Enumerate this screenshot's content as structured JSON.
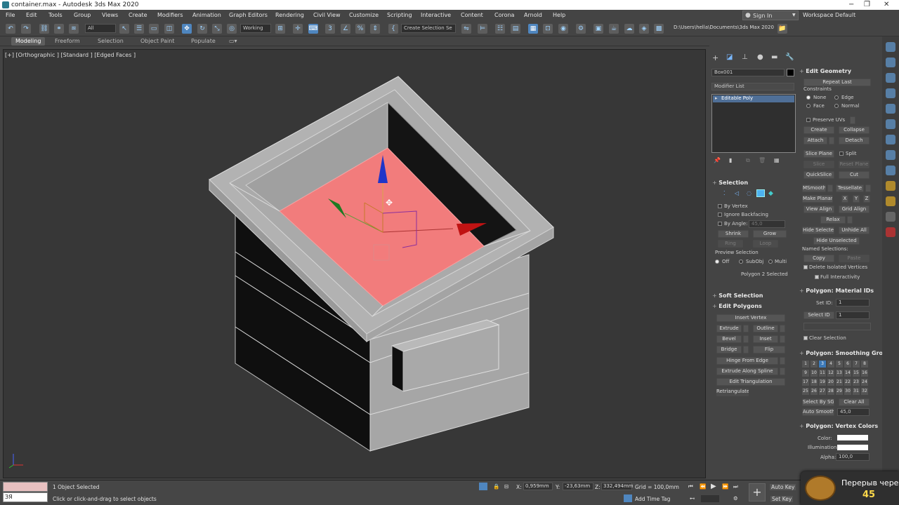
{
  "window": {
    "title": "container.max - Autodesk 3ds Max 2020",
    "minimize": "−",
    "restore": "❐",
    "close": "✕"
  },
  "menus": [
    "File",
    "Edit",
    "Tools",
    "Group",
    "Views",
    "Create",
    "Modifiers",
    "Animation",
    "Graph Editors",
    "Rendering",
    "Civil View",
    "Customize",
    "Scripting",
    "Interactive",
    "Content",
    "Corona",
    "Arnold",
    "Help"
  ],
  "account": {
    "sign_in": "Sign In",
    "workspaces_label": "Workspaces:",
    "workspace": "Default"
  },
  "toolbar": {
    "filter": "All",
    "ref_coord": "Working",
    "selection_set": "Create Selection Se",
    "project_path": "D:\\Users\\hella\\Documents\\3ds Max 2020"
  },
  "ribbon_tabs": [
    "Modeling",
    "Freeform",
    "Selection",
    "Object Paint",
    "Populate"
  ],
  "viewport": {
    "label": "[+] [Orthographic ] [Standard ] [Edged Faces ]"
  },
  "command_panel": {
    "object_name": "Box001",
    "modifier_list": "Modifier List",
    "stack_item": "Editable Poly"
  },
  "selection": {
    "title": "Selection",
    "by_vertex": "By Vertex",
    "ignore_backfacing": "Ignore Backfacing",
    "by_angle": "By Angle:",
    "angle_value": "45,0",
    "shrink": "Shrink",
    "grow": "Grow",
    "ring": "Ring",
    "loop": "Loop",
    "preview_selection": "Preview Selection",
    "off": "Off",
    "subobj": "SubObj",
    "multi": "Multi",
    "status": "Polygon 2 Selected"
  },
  "soft_selection": {
    "title": "Soft Selection"
  },
  "edit_polygons": {
    "title": "Edit Polygons",
    "insert_vertex": "Insert Vertex",
    "extrude": "Extrude",
    "outline": "Outline",
    "bevel": "Bevel",
    "inset": "Inset",
    "bridge": "Bridge",
    "flip": "Flip",
    "hinge": "Hinge From Edge",
    "extrude_spline": "Extrude Along Spline",
    "edit_triangulation": "Edit Triangulation",
    "retriangulate": "Retriangulate"
  },
  "edit_geometry": {
    "title": "Edit Geometry",
    "repeat_last": "Repeat Last",
    "constraints": "Constraints",
    "none": "None",
    "edge": "Edge",
    "face": "Face",
    "normal": "Normal",
    "preserve_uvs": "Preserve UVs",
    "create": "Create",
    "collapse": "Collapse",
    "attach": "Attach",
    "detach": "Detach",
    "slice_plane": "Slice Plane",
    "split": "Split",
    "slice": "Slice",
    "reset_plane": "Reset Plane",
    "quickslice": "QuickSlice",
    "cut": "Cut",
    "msmooth": "MSmooth",
    "tessellate": "Tessellate",
    "make_planar": "Make Planar",
    "x": "X",
    "y": "Y",
    "z": "Z",
    "view_align": "View Align",
    "grid_align": "Grid Align",
    "relax": "Relax",
    "hide_selected": "Hide Selected",
    "unhide_all": "Unhide All",
    "hide_unselected": "Hide Unselected",
    "named_selections": "Named Selections:",
    "copy": "Copy",
    "paste": "Paste",
    "delete_isolated": "Delete Isolated Vertices",
    "full_interactivity": "Full Interactivity"
  },
  "material_ids": {
    "title": "Polygon: Material IDs",
    "set_id": "Set ID:",
    "set_id_value": "1",
    "select_id": "Select ID",
    "select_id_value": "1",
    "clear_selection": "Clear Selection"
  },
  "smoothing": {
    "title": "Polygon: Smoothing Gro",
    "groups": [
      "1",
      "2",
      "3",
      "4",
      "5",
      "6",
      "7",
      "8",
      "9",
      "10",
      "11",
      "12",
      "13",
      "14",
      "15",
      "16",
      "17",
      "18",
      "19",
      "20",
      "21",
      "22",
      "23",
      "24",
      "25",
      "26",
      "27",
      "28",
      "29",
      "30",
      "31",
      "32"
    ],
    "active_group": "3",
    "select_by_sg": "Select By SG",
    "clear_all": "Clear All",
    "auto_smooth": "Auto Smooth",
    "auto_smooth_value": "45,0"
  },
  "vertex_colors": {
    "title": "Polygon: Vertex Colors",
    "color": "Color:",
    "illumination": "Illumination:",
    "alpha": "Alpha:",
    "alpha_value": "100,0"
  },
  "status": {
    "objects": "1 Object Selected",
    "hint": "Click or click-and-drag to select objects",
    "script_value": "ЗЯ",
    "x_label": "X:",
    "x": "0,959mm",
    "y_label": "Y:",
    "y": "-23,63mm",
    "z_label": "Z:",
    "z": "332,494mm",
    "grid": "Grid = 100,0mm",
    "add_time_tag": "Add Time Tag",
    "auto_key": "Auto Key",
    "set_key": "Set Key"
  },
  "overlay": {
    "text": "Перерыв через",
    "count": "45"
  },
  "colors": {
    "accent": "#4f86bf",
    "selected_face": "#f47c7c",
    "background": "#444444"
  }
}
